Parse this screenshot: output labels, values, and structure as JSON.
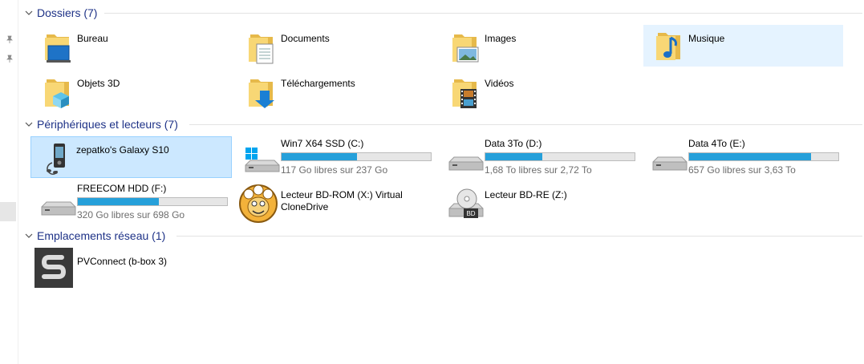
{
  "groups": {
    "folders": {
      "title": "Dossiers (7)"
    },
    "devices": {
      "title": "Périphériques et lecteurs (7)"
    },
    "network": {
      "title": "Emplacements réseau (1)"
    }
  },
  "folders": [
    {
      "label": "Bureau",
      "icon": "desktop-folder-icon"
    },
    {
      "label": "Documents",
      "icon": "documents-folder-icon"
    },
    {
      "label": "Images",
      "icon": "pictures-folder-icon"
    },
    {
      "label": "Musique",
      "icon": "music-folder-icon"
    },
    {
      "label": "Objets 3D",
      "icon": "3d-objects-folder-icon"
    },
    {
      "label": "Téléchargements",
      "icon": "downloads-folder-icon"
    },
    {
      "label": "Vidéos",
      "icon": "videos-folder-icon"
    }
  ],
  "devices": [
    {
      "label": "zepatko's Galaxy S10",
      "icon": "phone-icon"
    },
    {
      "label": "Win7 X64 SSD (C:)",
      "free": "117 Go libres sur 237 Go",
      "usage": 0.506,
      "icon": "windows-drive-icon"
    },
    {
      "label": "Data 3To (D:)",
      "free": "1,68 To libres sur 2,72 To",
      "usage": 0.382,
      "icon": "hard-drive-icon"
    },
    {
      "label": "Data 4To (E:)",
      "free": "657 Go libres sur 3,63 To",
      "usage": 0.819,
      "icon": "hard-drive-icon"
    },
    {
      "label": "FREECOM HDD (F:)",
      "free": "320 Go libres sur 698 Go",
      "usage": 0.542,
      "icon": "hard-drive-icon"
    },
    {
      "label": "Lecteur BD-ROM (X:) Virtual CloneDrive",
      "icon": "clonedrive-sheep-icon"
    },
    {
      "label": "Lecteur BD-RE (Z:)",
      "icon": "bd-drive-icon",
      "badge": "BD"
    }
  ],
  "network": [
    {
      "label": "PVConnect (b-box 3)",
      "icon": "pvconnect-icon"
    }
  ],
  "colors": {
    "accent": "#1e3287",
    "bar": "#26a0da",
    "selection": "#cce8ff",
    "hover": "#e5f3ff"
  }
}
